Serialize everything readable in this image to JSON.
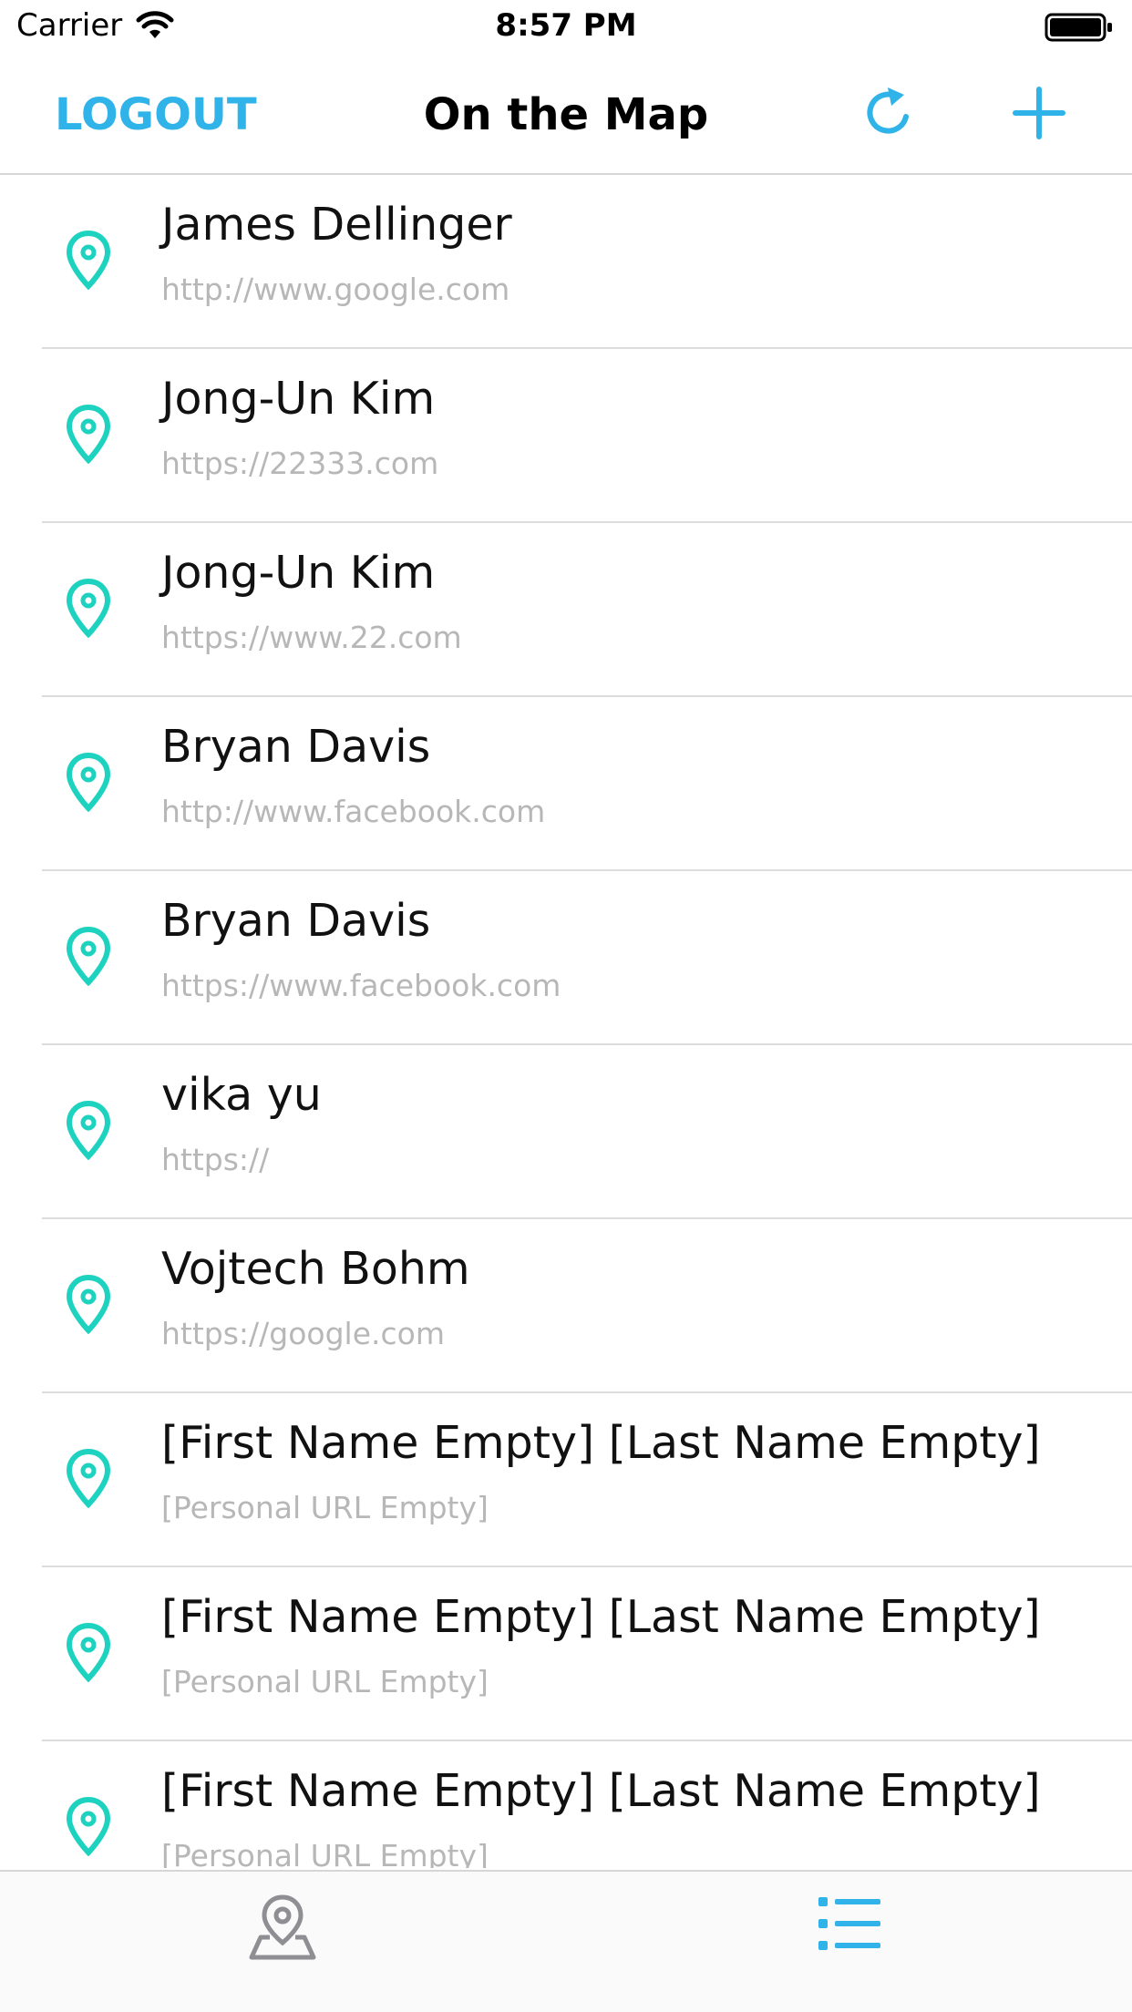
{
  "status_bar": {
    "carrier": "Carrier",
    "time": "8:57 PM"
  },
  "nav": {
    "logout_label": "LOGOUT",
    "title": "On the Map",
    "refresh_icon": "refresh-icon",
    "add_icon": "plus-icon"
  },
  "accent_color": "#2fb3e8",
  "pin_color": "#1dd3c0",
  "students": [
    {
      "name": "James Dellinger",
      "url": "http://www.google.com"
    },
    {
      "name": "Jong-Un Kim",
      "url": "https://22333.com"
    },
    {
      "name": "Jong-Un Kim",
      "url": "https://www.22.com"
    },
    {
      "name": "Bryan Davis",
      "url": "http://www.facebook.com"
    },
    {
      "name": "Bryan Davis",
      "url": "https://www.facebook.com"
    },
    {
      "name": "vika yu",
      "url": "https://"
    },
    {
      "name": "Vojtech Bohm",
      "url": "https://google.com"
    },
    {
      "name": "[First Name Empty] [Last Name Empty]",
      "url": "[Personal URL Empty]"
    },
    {
      "name": "[First Name Empty] [Last Name Empty]",
      "url": "[Personal URL Empty]"
    },
    {
      "name": "[First Name Empty] [Last Name Empty]",
      "url": "[Personal URL Empty]"
    }
  ],
  "tabs": [
    {
      "icon": "map-pin-icon",
      "selected": false
    },
    {
      "icon": "list-icon",
      "selected": true
    }
  ]
}
